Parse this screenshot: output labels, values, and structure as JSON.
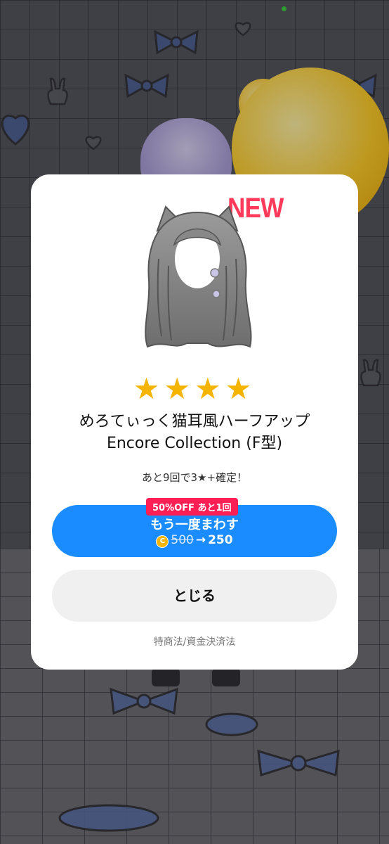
{
  "modal": {
    "new_badge": "NEW",
    "rarity_stars": 4,
    "item_name_line1": "めろてぃっく猫耳風ハーフアップ",
    "item_name_line2": "Encore Collection (F型)",
    "guarantee_text": "あと9回で3★+確定！",
    "discount_badge": "50%OFF あと1回",
    "spin_button": {
      "label": "もう一度まわす",
      "old_price": "500",
      "arrow": "→",
      "new_price": "250",
      "coin_symbol": "C"
    },
    "close_button_label": "とじる",
    "legal_link": "特商法/資金決済法"
  },
  "colors": {
    "accent_blue": "#1a8cff",
    "new_badge": "#ff3a5a",
    "discount_badge": "#ff1f55",
    "star": "#f5b400"
  },
  "icons": [
    "star-icon",
    "coin-icon",
    "arrow-icon",
    "heart-icon",
    "bow-icon",
    "bunny-icon"
  ]
}
